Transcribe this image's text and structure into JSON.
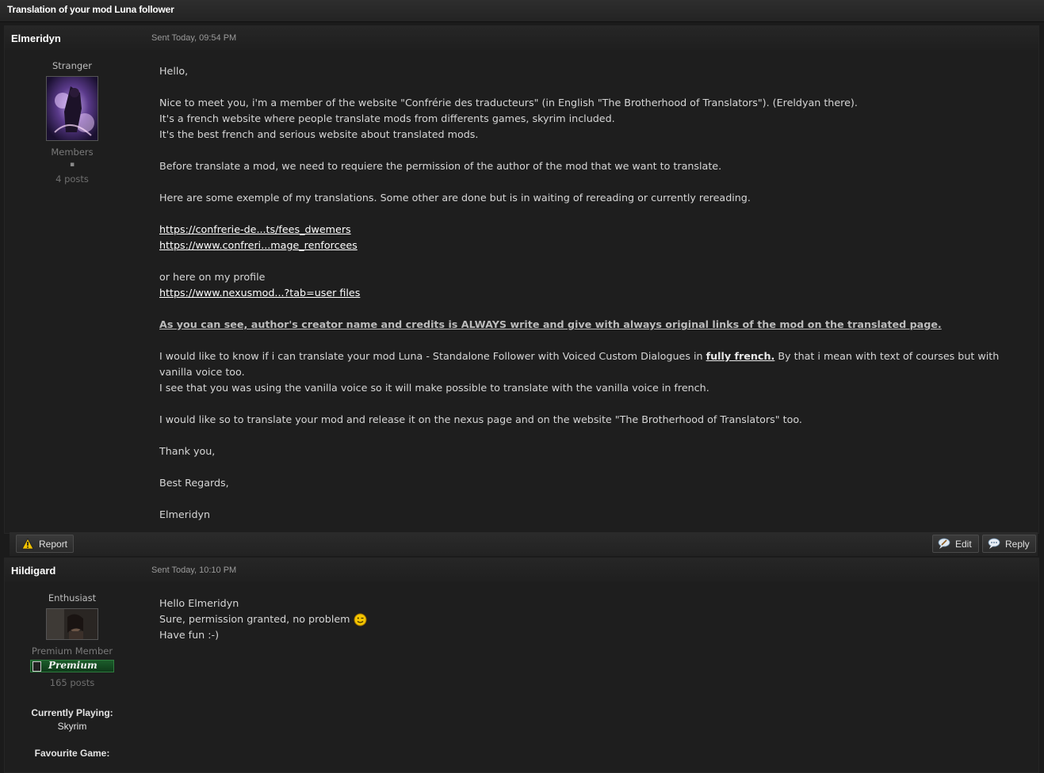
{
  "topic": {
    "title": "Translation of your mod Luna follower"
  },
  "posts": [
    {
      "author": "Elmeridyn",
      "sent": "Sent Today, 09:54 PM",
      "rank": "Stranger",
      "group": "Members",
      "pips": "▪",
      "post_count": "4 posts",
      "body": {
        "greeting": "Hello,",
        "p1": "Nice to meet you, i'm a member of the website \"Confrérie des traducteurs\" (in English \"The Brotherhood of Translators\"). (Ereldyan there).",
        "p2": "It's a french website where people translate mods from differents games, skyrim included.",
        "p3": "It's the best french and serious website about translated mods.",
        "p4": "Before translate a mod, we need to requiere the permission of the author of the mod that we want to translate.",
        "p5": "Here are some exemple of my translations. Some other are done but is in waiting of rereading or currently rereading.",
        "link1": "https://confrerie-de...ts/fees_dwemers",
        "link2": "https://www.confreri...mage_renforcees",
        "p6": "or here on my profile",
        "link3": "https://www.nexusmod...?tab=user files",
        "p7": "As you can see, author's creator name and credits is ALWAYS write and give with always original links of the mod on the translated page.",
        "p8a": "I would like to know if i can translate your mod Luna - Standalone Follower with Voiced Custom Dialogues in ",
        "p8b": "fully french.",
        "p8c": " By that i mean with text of courses but with vanilla voice too.",
        "p9": "I see that you was using the vanilla voice so it will make possible to translate with the vanilla voice in french.",
        "p10": "I would like so to translate your mod and release it on the nexus page and on the website \"The Brotherhood of Translators\" too.",
        "p11": "Thank you,",
        "p12": "Best Regards,",
        "p13": "Elmeridyn"
      }
    },
    {
      "author": "Hildigard",
      "sent": "Sent Today, 10:10 PM",
      "rank": "Enthusiast",
      "group": "Premium Member",
      "badge": "Premium",
      "post_count": "165 posts",
      "currently_playing_label": "Currently Playing:",
      "currently_playing": "Skyrim",
      "favourite_game_label": "Favourite Game:",
      "body": {
        "l1": "Hello Elmeridyn",
        "l2": "Sure, permission granted, no problem",
        "l3": "Have fun :-)"
      }
    }
  ],
  "actions": {
    "report": "Report",
    "edit": "Edit",
    "reply": "Reply"
  },
  "icons": {
    "report": "warning-icon",
    "edit": "edit-bubble-icon",
    "reply": "reply-bubble-icon",
    "smiley": "wink-smiley-icon"
  }
}
